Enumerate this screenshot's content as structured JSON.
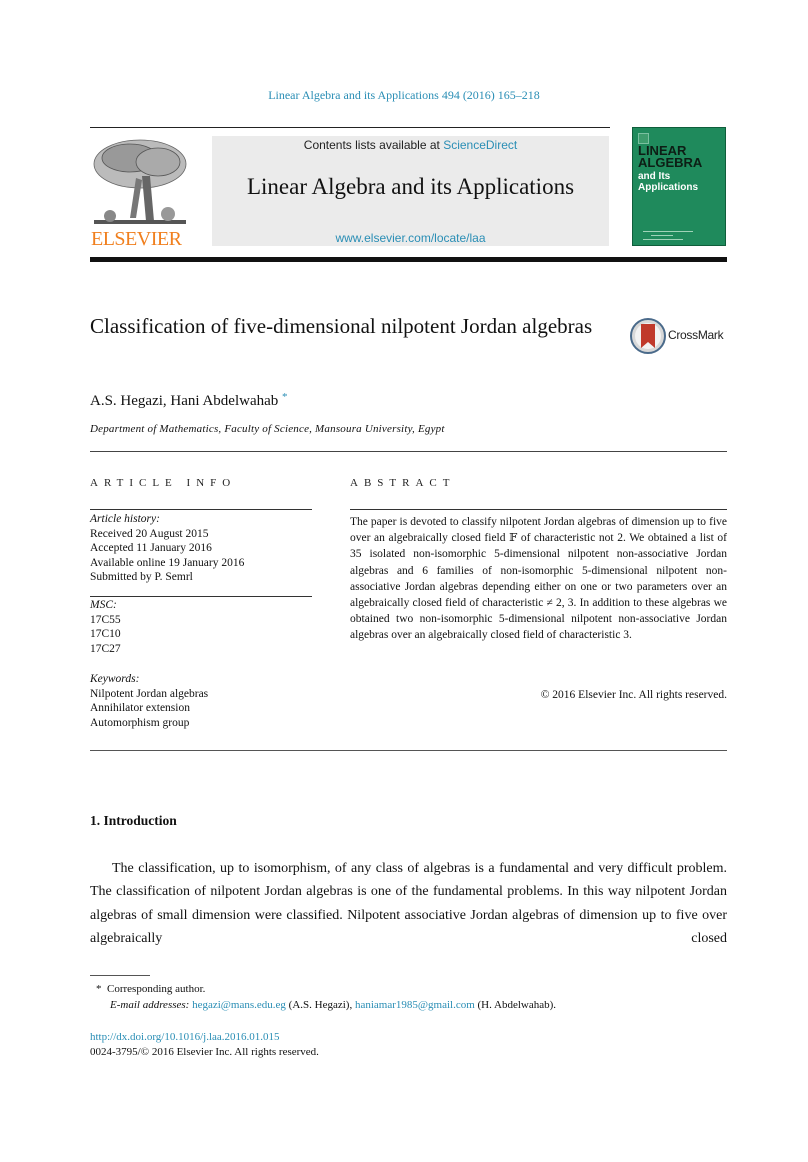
{
  "running_head": "Linear Algebra and its Applications 494 (2016) 165–218",
  "masthead": {
    "publisher_logo_text": "ELSEVIER",
    "contents_prefix": "Contents lists available at ",
    "contents_link": "ScienceDirect",
    "journal_title": "Linear Algebra and its Applications",
    "journal_url": "www.elsevier.com/locate/laa",
    "cover": {
      "title_line1": "LINEAR",
      "title_line2": "ALGEBRA",
      "subtitle_line1": "and Its",
      "subtitle_line2": "Applications",
      "color": "#1f8a5c"
    }
  },
  "article": {
    "title": "Classification of five-dimensional nilpotent Jordan algebras",
    "crossmark_label": "CrossMark",
    "authors": "A.S. Hegazi, Hani Abdelwahab",
    "corresponding_marker": "*",
    "affiliation": "Department of Mathematics, Faculty of Science, Mansoura University, Egypt"
  },
  "article_info": {
    "heading": "ARTICLE INFO",
    "history_label": "Article history:",
    "history": [
      "Received 20 August 2015",
      "Accepted 11 January 2016",
      "Available online 19 January 2016",
      "Submitted by P. Semrl"
    ],
    "msc_label": "MSC:",
    "msc": [
      "17C55",
      "17C10",
      "17C27"
    ],
    "keywords_label": "Keywords:",
    "keywords": [
      "Nilpotent Jordan algebras",
      "Annihilator extension",
      "Automorphism group"
    ]
  },
  "abstract": {
    "heading": "ABSTRACT",
    "text": "The paper is devoted to classify nilpotent Jordan algebras of dimension up to five over an algebraically closed field 𝔽 of characteristic not 2. We obtained a list of 35 isolated non-isomorphic 5-dimensional nilpotent non-associative Jordan algebras and 6 families of non-isomorphic 5-dimensional nilpotent non-associative Jordan algebras depending either on one or two parameters over an algebraically closed field of characteristic ≠ 2, 3. In addition to these algebras we obtained two non-isomorphic 5-dimensional nilpotent non-associative Jordan algebras over an algebraically closed field of characteristic 3.",
    "copyright": "© 2016 Elsevier Inc. All rights reserved."
  },
  "section": {
    "heading": "1.  Introduction",
    "paragraph": "The classification, up to isomorphism, of any class of algebras is a fundamental and very difficult problem. The classification of nilpotent Jordan algebras is one of the fundamental problems. In this way nilpotent Jordan algebras of small dimension were classified. Nilpotent associative Jordan algebras of dimension up to five over algebraically closed"
  },
  "footnote": {
    "marker": "*",
    "corresponding": "Corresponding author.",
    "email_label": "E-mail addresses:",
    "email1": "hegazi@mans.edu.eg",
    "email1_owner": " (A.S. Hegazi), ",
    "email2": "haniamar1985@gmail.com",
    "email2_owner": " (H. Abdelwahab)."
  },
  "doi": "http://dx.doi.org/10.1016/j.laa.2016.01.015",
  "issn_line": "0024-3795/© 2016 Elsevier Inc. All rights reserved.",
  "colors": {
    "link": "#2a8eb5",
    "elsevier_orange": "#f07f1e",
    "masthead_bg": "#ebebeb"
  }
}
